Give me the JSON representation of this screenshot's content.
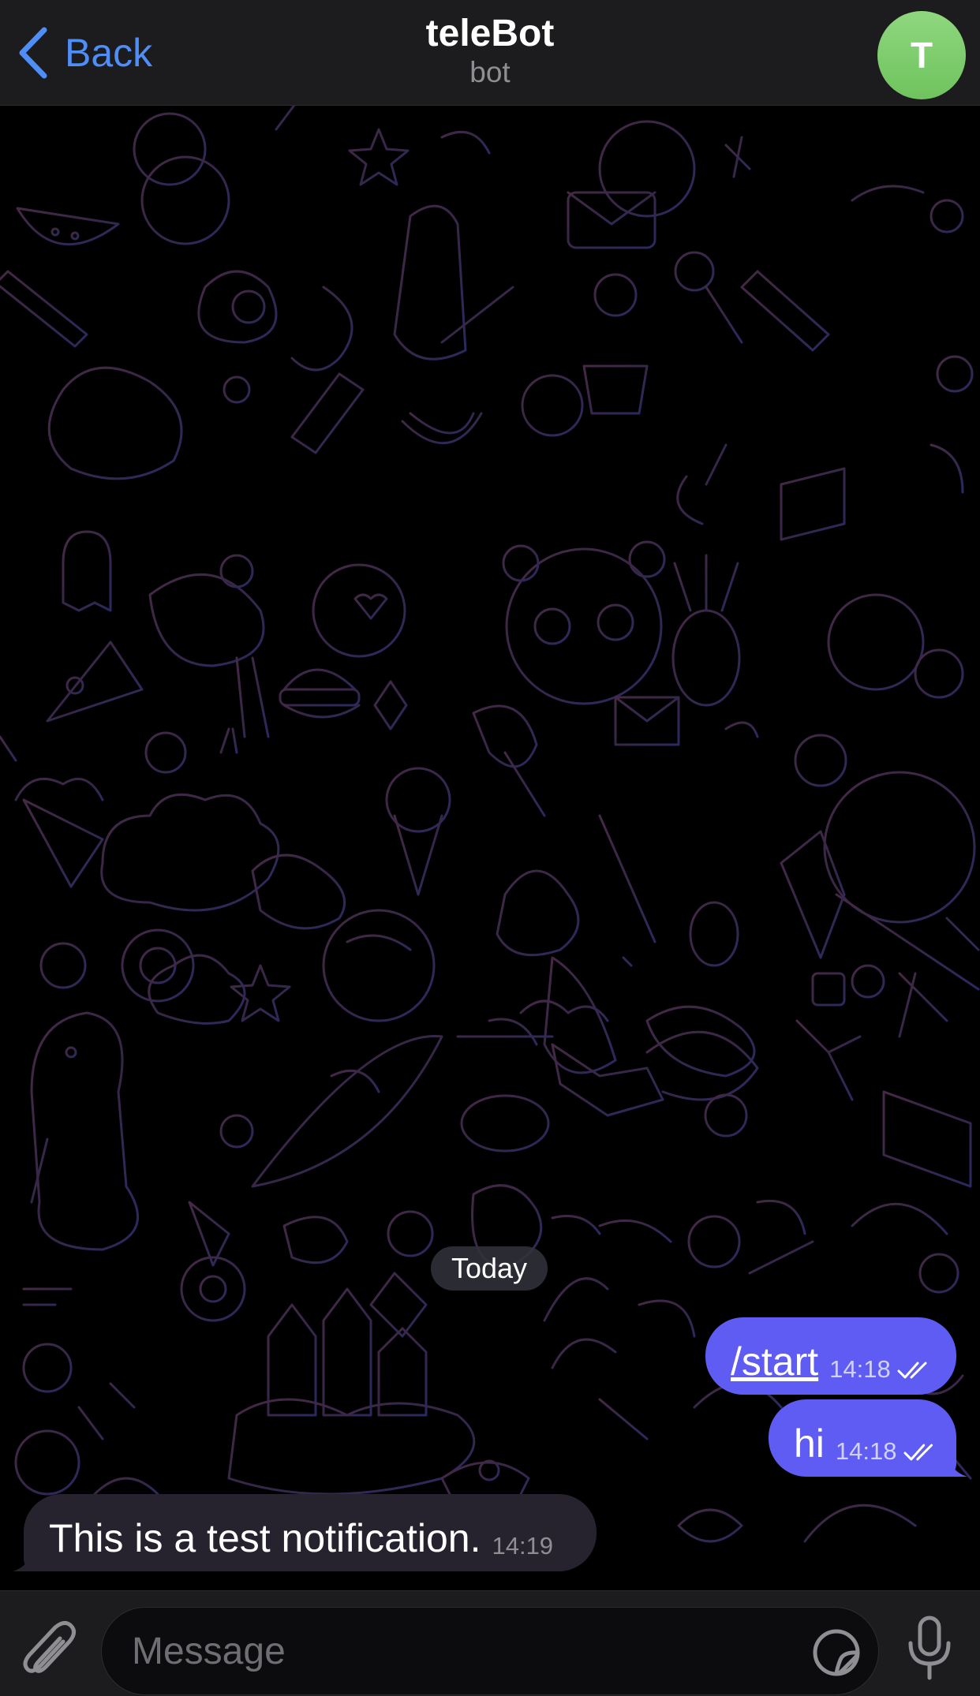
{
  "header": {
    "back_label": "Back",
    "title": "teleBot",
    "subtitle": "bot",
    "avatar_initial": "T",
    "avatar_color": "#7ccc6a",
    "accent_color": "#4f8ef7"
  },
  "chat": {
    "date_divider": "Today",
    "outgoing_color": "#5e5cf2",
    "incoming_color": "#26232f",
    "messages": [
      {
        "direction": "out",
        "text": "/start",
        "time": "14:18",
        "status": "read",
        "status_icon": "double-check-icon"
      },
      {
        "direction": "out",
        "text": "hi",
        "time": "14:18",
        "status": "read",
        "status_icon": "double-check-icon"
      },
      {
        "direction": "in",
        "text": "This is a test notification.",
        "time": "14:19"
      }
    ]
  },
  "composer": {
    "placeholder": "Message",
    "value": "",
    "attach_icon": "paperclip-icon",
    "sticker_icon": "sticker-icon",
    "mic_icon": "microphone-icon"
  }
}
